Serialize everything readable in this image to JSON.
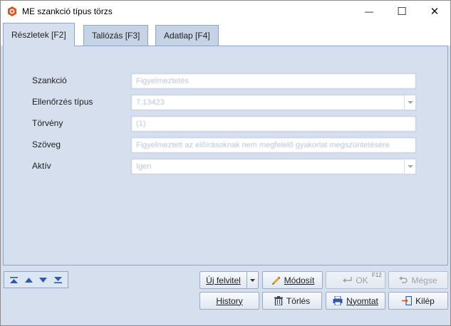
{
  "window": {
    "title": "ME szankció típus törzs",
    "minimize_symbol": "—",
    "maximize_symbol": "☐",
    "close_symbol": "✕"
  },
  "tabs": [
    {
      "label": "Részletek [F2]",
      "active": true
    },
    {
      "label": "Tallózás [F3]",
      "active": false
    },
    {
      "label": "Adatlap [F4]",
      "active": false
    }
  ],
  "form": {
    "fields": [
      {
        "label": "Szankció",
        "value": "Figyelmeztetés",
        "type": "text"
      },
      {
        "label": "Ellenőrzés típus",
        "value": "7.13423",
        "type": "combo"
      },
      {
        "label": "Törvény",
        "value": "(1)",
        "type": "text"
      },
      {
        "label": "Szöveg",
        "value": "Figyelmeztett az előírásoknak nem megfelelő gyakorlat megszüntetésére",
        "type": "text"
      },
      {
        "label": "Aktív",
        "value": "Igen",
        "type": "combo"
      }
    ]
  },
  "navigation": {
    "first_icon": "first-record-icon",
    "prev_icon": "prev-record-icon",
    "next_icon": "next-record-icon",
    "last_icon": "last-record-icon"
  },
  "buttons": {
    "new_label": "Új felvitel",
    "modify_label": "Módosít",
    "ok_label": "OK",
    "ok_shortcut": "F12",
    "cancel_label": "Mégse",
    "history_label": "History",
    "delete_label": "Törlés",
    "print_label": "Nyomtat",
    "exit_label": "Kilép"
  },
  "colors": {
    "accent": "#d9541e",
    "panel_bg": "#d5dfee",
    "disabled_text": "#9aa3ae"
  }
}
